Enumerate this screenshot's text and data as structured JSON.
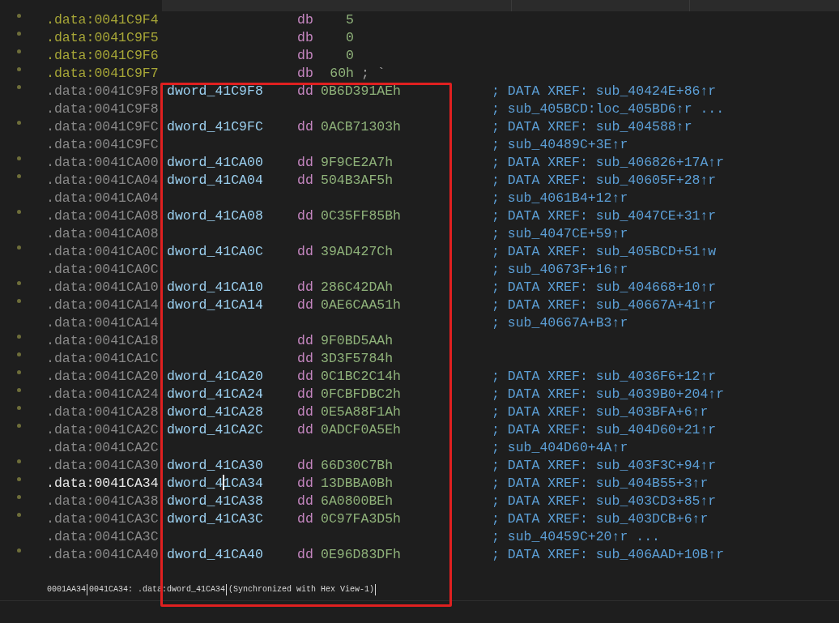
{
  "listing": [
    {
      "kind": "byte",
      "dot": true,
      "current": false,
      "address": ".data:0041C9F4",
      "mnemonic": "db",
      "operand": "5"
    },
    {
      "kind": "byte",
      "dot": true,
      "current": false,
      "address": ".data:0041C9F5",
      "mnemonic": "db",
      "operand": "0"
    },
    {
      "kind": "byte",
      "dot": true,
      "current": false,
      "address": ".data:0041C9F6",
      "mnemonic": "db",
      "operand": "0"
    },
    {
      "kind": "byte",
      "dot": true,
      "current": false,
      "address": ".data:0041C9F7",
      "mnemonic": "db",
      "operand": "60h",
      "inline_comment": "; `"
    },
    {
      "kind": "dword",
      "dot": true,
      "current": false,
      "address": ".data:0041C9F8",
      "label": "dword_41C9F8",
      "mnemonic": "dd",
      "operand": "0B6D391AEh",
      "comment": "; DATA XREF: sub_40424E+86↑r"
    },
    {
      "kind": "dword",
      "dot": false,
      "current": false,
      "address": ".data:0041C9F8",
      "comment": "; sub_405BCD:loc_405BD6↑r ..."
    },
    {
      "kind": "dword",
      "dot": true,
      "current": false,
      "address": ".data:0041C9FC",
      "label": "dword_41C9FC",
      "mnemonic": "dd",
      "operand": "0ACB71303h",
      "comment": "; DATA XREF: sub_404588↑r"
    },
    {
      "kind": "dword",
      "dot": false,
      "current": false,
      "address": ".data:0041C9FC",
      "comment": "; sub_40489C+3E↑r"
    },
    {
      "kind": "dword",
      "dot": true,
      "current": false,
      "address": ".data:0041CA00",
      "label": "dword_41CA00",
      "mnemonic": "dd",
      "operand": "9F9CE2A7h",
      "comment": "; DATA XREF: sub_406826+17A↑r"
    },
    {
      "kind": "dword",
      "dot": true,
      "current": false,
      "address": ".data:0041CA04",
      "label": "dword_41CA04",
      "mnemonic": "dd",
      "operand": "504B3AF5h",
      "comment": "; DATA XREF: sub_40605F+28↑r"
    },
    {
      "kind": "dword",
      "dot": false,
      "current": false,
      "address": ".data:0041CA04",
      "comment": "; sub_4061B4+12↑r"
    },
    {
      "kind": "dword",
      "dot": true,
      "current": false,
      "address": ".data:0041CA08",
      "label": "dword_41CA08",
      "mnemonic": "dd",
      "operand": "0C35FF85Bh",
      "comment": "; DATA XREF: sub_4047CE+31↑r"
    },
    {
      "kind": "dword",
      "dot": false,
      "current": false,
      "address": ".data:0041CA08",
      "comment": "; sub_4047CE+59↑r"
    },
    {
      "kind": "dword",
      "dot": true,
      "current": false,
      "address": ".data:0041CA0C",
      "label": "dword_41CA0C",
      "mnemonic": "dd",
      "operand": "39AD427Ch",
      "comment": "; DATA XREF: sub_405BCD+51↑w"
    },
    {
      "kind": "dword",
      "dot": false,
      "current": false,
      "address": ".data:0041CA0C",
      "comment": "; sub_40673F+16↑r"
    },
    {
      "kind": "dword",
      "dot": true,
      "current": false,
      "address": ".data:0041CA10",
      "label": "dword_41CA10",
      "mnemonic": "dd",
      "operand": "286C42DAh",
      "comment": "; DATA XREF: sub_404668+10↑r"
    },
    {
      "kind": "dword",
      "dot": true,
      "current": false,
      "address": ".data:0041CA14",
      "label": "dword_41CA14",
      "mnemonic": "dd",
      "operand": "0AE6CAA51h",
      "comment": "; DATA XREF: sub_40667A+41↑r"
    },
    {
      "kind": "dword",
      "dot": false,
      "current": false,
      "address": ".data:0041CA14",
      "comment": "; sub_40667A+B3↑r"
    },
    {
      "kind": "dword",
      "dot": true,
      "current": false,
      "address": ".data:0041CA18",
      "mnemonic": "dd",
      "operand": "9F0BD5AAh"
    },
    {
      "kind": "dword",
      "dot": true,
      "current": false,
      "address": ".data:0041CA1C",
      "mnemonic": "dd",
      "operand": "3D3F5784h"
    },
    {
      "kind": "dword",
      "dot": true,
      "current": false,
      "address": ".data:0041CA20",
      "label": "dword_41CA20",
      "mnemonic": "dd",
      "operand": "0C1BC2C14h",
      "comment": "; DATA XREF: sub_4036F6+12↑r"
    },
    {
      "kind": "dword",
      "dot": true,
      "current": false,
      "address": ".data:0041CA24",
      "label": "dword_41CA24",
      "mnemonic": "dd",
      "operand": "0FCBFDBC2h",
      "comment": "; DATA XREF: sub_4039B0+204↑r"
    },
    {
      "kind": "dword",
      "dot": true,
      "current": false,
      "address": ".data:0041CA28",
      "label": "dword_41CA28",
      "mnemonic": "dd",
      "operand": "0E5A88F1Ah",
      "comment": "; DATA XREF: sub_403BFA+6↑r"
    },
    {
      "kind": "dword",
      "dot": true,
      "current": false,
      "address": ".data:0041CA2C",
      "label": "dword_41CA2C",
      "mnemonic": "dd",
      "operand": "0ADCF0A5Eh",
      "comment": "; DATA XREF: sub_404D60+21↑r"
    },
    {
      "kind": "dword",
      "dot": false,
      "current": false,
      "address": ".data:0041CA2C",
      "comment": "; sub_404D60+4A↑r"
    },
    {
      "kind": "dword",
      "dot": true,
      "current": false,
      "address": ".data:0041CA30",
      "label": "dword_41CA30",
      "mnemonic": "dd",
      "operand": "66D30C7Bh",
      "comment": "; DATA XREF: sub_403F3C+94↑r"
    },
    {
      "kind": "dword",
      "dot": true,
      "current": true,
      "address": ".data:0041CA34",
      "label": "dword_41CA34",
      "mnemonic": "dd",
      "operand": "13DBBA0Bh",
      "comment": "; DATA XREF: sub_404B55+3↑r"
    },
    {
      "kind": "dword",
      "dot": true,
      "current": false,
      "address": ".data:0041CA38",
      "label": "dword_41CA38",
      "mnemonic": "dd",
      "operand": "6A0800BEh",
      "comment": "; DATA XREF: sub_403CD3+85↑r"
    },
    {
      "kind": "dword",
      "dot": true,
      "current": false,
      "address": ".data:0041CA3C",
      "label": "dword_41CA3C",
      "mnemonic": "dd",
      "operand": "0C97FA3D5h",
      "comment": "; DATA XREF: sub_403DCB+6↑r"
    },
    {
      "kind": "dword",
      "dot": false,
      "current": false,
      "address": ".data:0041CA3C",
      "comment": "; sub_40459C+20↑r ..."
    },
    {
      "kind": "dword",
      "dot": true,
      "current": false,
      "address": ".data:0041CA40",
      "label": "dword_41CA40",
      "mnemonic": "dd",
      "operand": "0E96D83DFh",
      "comment": "; DATA XREF: sub_406AAD+10B↑r"
    }
  ],
  "status_line": [
    "0001AA34",
    "0041CA34: .data:dword_41CA34",
    "(Synchronized with Hex View-1)"
  ]
}
